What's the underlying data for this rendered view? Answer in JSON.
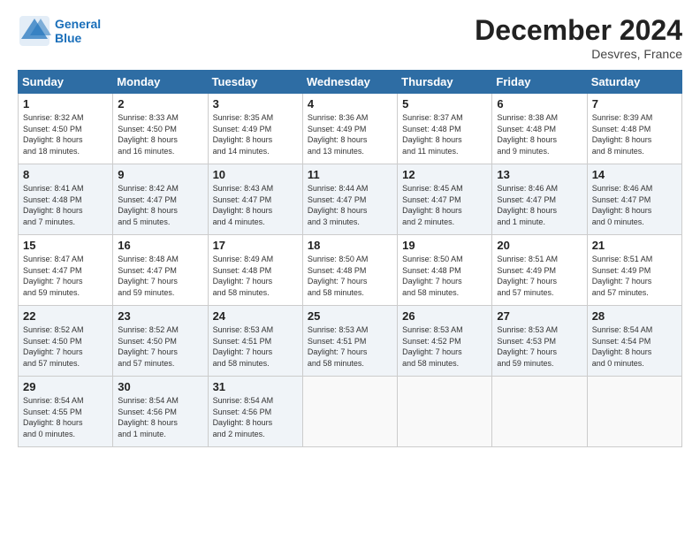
{
  "header": {
    "logo_line1": "General",
    "logo_line2": "Blue",
    "month": "December 2024",
    "location": "Desvres, France"
  },
  "days_of_week": [
    "Sunday",
    "Monday",
    "Tuesday",
    "Wednesday",
    "Thursday",
    "Friday",
    "Saturday"
  ],
  "weeks": [
    [
      {
        "day": "1",
        "info": "Sunrise: 8:32 AM\nSunset: 4:50 PM\nDaylight: 8 hours\nand 18 minutes."
      },
      {
        "day": "2",
        "info": "Sunrise: 8:33 AM\nSunset: 4:50 PM\nDaylight: 8 hours\nand 16 minutes."
      },
      {
        "day": "3",
        "info": "Sunrise: 8:35 AM\nSunset: 4:49 PM\nDaylight: 8 hours\nand 14 minutes."
      },
      {
        "day": "4",
        "info": "Sunrise: 8:36 AM\nSunset: 4:49 PM\nDaylight: 8 hours\nand 13 minutes."
      },
      {
        "day": "5",
        "info": "Sunrise: 8:37 AM\nSunset: 4:48 PM\nDaylight: 8 hours\nand 11 minutes."
      },
      {
        "day": "6",
        "info": "Sunrise: 8:38 AM\nSunset: 4:48 PM\nDaylight: 8 hours\nand 9 minutes."
      },
      {
        "day": "7",
        "info": "Sunrise: 8:39 AM\nSunset: 4:48 PM\nDaylight: 8 hours\nand 8 minutes."
      }
    ],
    [
      {
        "day": "8",
        "info": "Sunrise: 8:41 AM\nSunset: 4:48 PM\nDaylight: 8 hours\nand 7 minutes."
      },
      {
        "day": "9",
        "info": "Sunrise: 8:42 AM\nSunset: 4:47 PM\nDaylight: 8 hours\nand 5 minutes."
      },
      {
        "day": "10",
        "info": "Sunrise: 8:43 AM\nSunset: 4:47 PM\nDaylight: 8 hours\nand 4 minutes."
      },
      {
        "day": "11",
        "info": "Sunrise: 8:44 AM\nSunset: 4:47 PM\nDaylight: 8 hours\nand 3 minutes."
      },
      {
        "day": "12",
        "info": "Sunrise: 8:45 AM\nSunset: 4:47 PM\nDaylight: 8 hours\nand 2 minutes."
      },
      {
        "day": "13",
        "info": "Sunrise: 8:46 AM\nSunset: 4:47 PM\nDaylight: 8 hours\nand 1 minute."
      },
      {
        "day": "14",
        "info": "Sunrise: 8:46 AM\nSunset: 4:47 PM\nDaylight: 8 hours\nand 0 minutes."
      }
    ],
    [
      {
        "day": "15",
        "info": "Sunrise: 8:47 AM\nSunset: 4:47 PM\nDaylight: 7 hours\nand 59 minutes."
      },
      {
        "day": "16",
        "info": "Sunrise: 8:48 AM\nSunset: 4:47 PM\nDaylight: 7 hours\nand 59 minutes."
      },
      {
        "day": "17",
        "info": "Sunrise: 8:49 AM\nSunset: 4:48 PM\nDaylight: 7 hours\nand 58 minutes."
      },
      {
        "day": "18",
        "info": "Sunrise: 8:50 AM\nSunset: 4:48 PM\nDaylight: 7 hours\nand 58 minutes."
      },
      {
        "day": "19",
        "info": "Sunrise: 8:50 AM\nSunset: 4:48 PM\nDaylight: 7 hours\nand 58 minutes."
      },
      {
        "day": "20",
        "info": "Sunrise: 8:51 AM\nSunset: 4:49 PM\nDaylight: 7 hours\nand 57 minutes."
      },
      {
        "day": "21",
        "info": "Sunrise: 8:51 AM\nSunset: 4:49 PM\nDaylight: 7 hours\nand 57 minutes."
      }
    ],
    [
      {
        "day": "22",
        "info": "Sunrise: 8:52 AM\nSunset: 4:50 PM\nDaylight: 7 hours\nand 57 minutes."
      },
      {
        "day": "23",
        "info": "Sunrise: 8:52 AM\nSunset: 4:50 PM\nDaylight: 7 hours\nand 57 minutes."
      },
      {
        "day": "24",
        "info": "Sunrise: 8:53 AM\nSunset: 4:51 PM\nDaylight: 7 hours\nand 58 minutes."
      },
      {
        "day": "25",
        "info": "Sunrise: 8:53 AM\nSunset: 4:51 PM\nDaylight: 7 hours\nand 58 minutes."
      },
      {
        "day": "26",
        "info": "Sunrise: 8:53 AM\nSunset: 4:52 PM\nDaylight: 7 hours\nand 58 minutes."
      },
      {
        "day": "27",
        "info": "Sunrise: 8:53 AM\nSunset: 4:53 PM\nDaylight: 7 hours\nand 59 minutes."
      },
      {
        "day": "28",
        "info": "Sunrise: 8:54 AM\nSunset: 4:54 PM\nDaylight: 8 hours\nand 0 minutes."
      }
    ],
    [
      {
        "day": "29",
        "info": "Sunrise: 8:54 AM\nSunset: 4:55 PM\nDaylight: 8 hours\nand 0 minutes."
      },
      {
        "day": "30",
        "info": "Sunrise: 8:54 AM\nSunset: 4:56 PM\nDaylight: 8 hours\nand 1 minute."
      },
      {
        "day": "31",
        "info": "Sunrise: 8:54 AM\nSunset: 4:56 PM\nDaylight: 8 hours\nand 2 minutes."
      },
      null,
      null,
      null,
      null
    ]
  ]
}
